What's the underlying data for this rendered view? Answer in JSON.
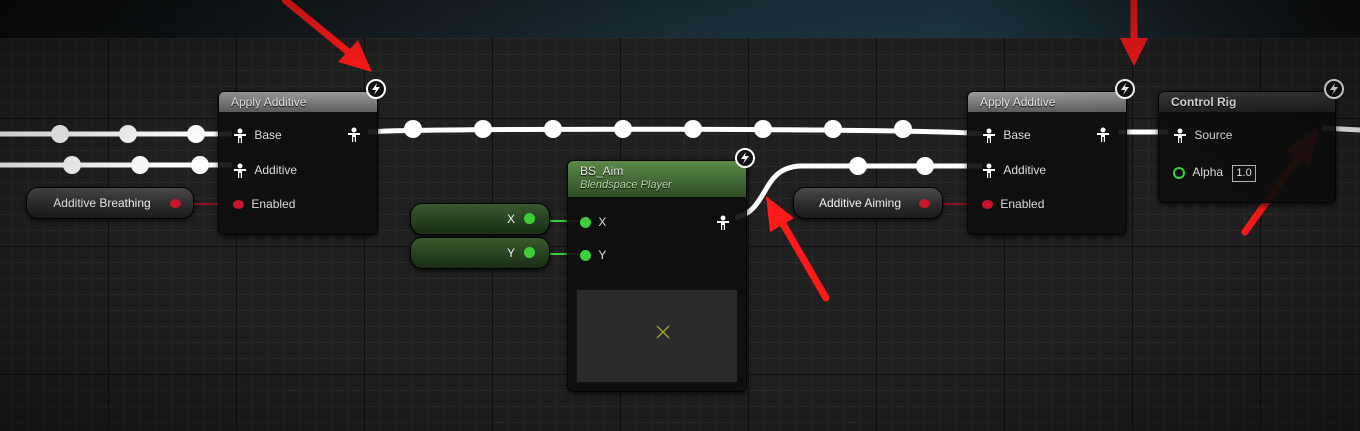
{
  "nodes": {
    "apply_additive_1": {
      "title": "Apply Additive",
      "pins": {
        "base": "Base",
        "additive": "Additive",
        "enabled": "Enabled"
      }
    },
    "bs_aim": {
      "title": "BS_Aim",
      "subtitle": "Blendspace Player",
      "pins": {
        "x": "X",
        "y": "Y"
      }
    },
    "apply_additive_2": {
      "title": "Apply Additive",
      "pins": {
        "base": "Base",
        "additive": "Additive",
        "enabled": "Enabled"
      }
    },
    "control_rig": {
      "title": "Control Rig",
      "pins": {
        "source": "Source",
        "alpha": "Alpha",
        "alpha_value": "1.0"
      }
    }
  },
  "variables": {
    "additive_breathing": "Additive Breathing",
    "additive_aiming": "Additive Aiming",
    "x": "X",
    "y": "Y"
  },
  "colors": {
    "pose_wire": "#ffffff",
    "bool_pin": "#c8152a",
    "float_pin": "#3bd03b",
    "annotation_arrow": "#ff1a1a"
  }
}
